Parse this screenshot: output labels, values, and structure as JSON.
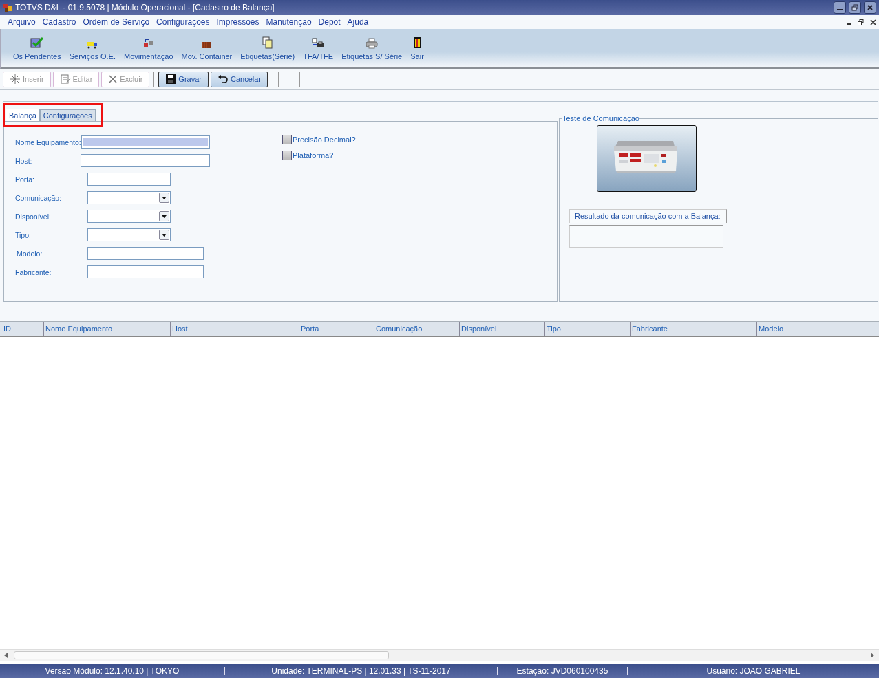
{
  "window": {
    "title": "TOTVS D&L - 01.9.5078 | Módulo Operacional - [Cadastro de Balança]"
  },
  "menu": [
    "Arquivo",
    "Cadastro",
    "Ordem de Serviço",
    "Configurações",
    "Impressões",
    "Manutenção",
    "Depot",
    "Ajuda"
  ],
  "toolbar": [
    {
      "label": "Os Pendentes",
      "kind": "check"
    },
    {
      "label": "Serviços O.E.",
      "kind": "truck"
    },
    {
      "label": "Movimentação",
      "kind": "move"
    },
    {
      "label": "Mov. Container",
      "kind": "container"
    },
    {
      "label": "Etiquetas(Série)",
      "kind": "pages"
    },
    {
      "label": "TFA/TFE",
      "kind": "transfer"
    },
    {
      "label": "Etiquetas S/ Série",
      "kind": "printer"
    },
    {
      "label": "Sair",
      "kind": "door"
    }
  ],
  "actions": [
    {
      "label": "Inserir",
      "kind": "insert",
      "disabled": true
    },
    {
      "label": "Editar",
      "kind": "edit",
      "disabled": true
    },
    {
      "label": "Excluir",
      "kind": "delete",
      "disabled": true
    },
    {
      "label": "Gravar",
      "kind": "save",
      "disabled": false
    },
    {
      "label": "Cancelar",
      "kind": "undo",
      "disabled": false
    }
  ],
  "tabs": [
    {
      "label": "Balança",
      "selected": true
    },
    {
      "label": "Configurações",
      "selected": false
    }
  ],
  "fields": [
    {
      "label": "Nome Equipamento:",
      "kind": "text",
      "focused": true
    },
    {
      "label": "Host:",
      "kind": "text",
      "focused": false
    },
    {
      "label": "Porta:",
      "kind": "text",
      "focused": false
    },
    {
      "label": "Comunicação:",
      "kind": "select",
      "focused": false
    },
    {
      "label": "Disponível:",
      "kind": "select",
      "focused": false
    },
    {
      "label": "Tipo:",
      "kind": "select",
      "focused": false
    },
    {
      "label": "Modelo:",
      "kind": "text",
      "focused": false
    },
    {
      "label": "Fabricante:",
      "kind": "text",
      "focused": false
    }
  ],
  "checkboxes": [
    {
      "label": "Precisão Decimal?",
      "checked": false
    },
    {
      "label": "Plataforma?",
      "checked": false
    }
  ],
  "test_panel": {
    "title": "Teste de Comunicação",
    "result_label": "Resultado da comunicação com a Balança:"
  },
  "table": {
    "columns": [
      "ID",
      "Nome Equipamento",
      "Host",
      "Porta",
      "Comunicação",
      "Disponível",
      "Tipo",
      "Fabricante",
      "Modelo"
    ]
  },
  "status_bar": [
    "Versão Módulo:  12.1.40.10  |  TOKYO",
    "Unidade: TERMINAL-PS | 12.01.33 | TS-11-2017",
    "Estação: JVD060100435",
    "Usuário: JOAO GABRIEL"
  ]
}
